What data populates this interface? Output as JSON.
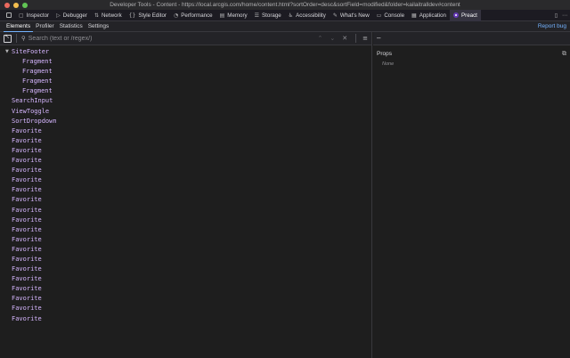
{
  "window": {
    "title": "Developer Tools - Content - https://local.arcgis.com/home/content.html?sortOrder=desc&sortField=modified&folder=kailaitralldev#content"
  },
  "toolbar": {
    "tabs": [
      {
        "label": "Inspector",
        "icon": "inspector-icon",
        "glyph": "▢"
      },
      {
        "label": "Debugger",
        "icon": "debugger-icon",
        "glyph": "▷"
      },
      {
        "label": "Network",
        "icon": "network-icon",
        "glyph": "⇅"
      },
      {
        "label": "Style Editor",
        "icon": "style-editor-icon",
        "glyph": "{}"
      },
      {
        "label": "Performance",
        "icon": "performance-icon",
        "glyph": "◔"
      },
      {
        "label": "Memory",
        "icon": "memory-icon",
        "glyph": "▤"
      },
      {
        "label": "Storage",
        "icon": "storage-icon",
        "glyph": "☰"
      },
      {
        "label": "Accessibility",
        "icon": "accessibility-icon",
        "glyph": "♿"
      },
      {
        "label": "What's New",
        "icon": "whats-new-icon",
        "glyph": "✎"
      },
      {
        "label": "Console",
        "icon": "console-icon",
        "glyph": "▭"
      },
      {
        "label": "Application",
        "icon": "application-icon",
        "glyph": "▦"
      },
      {
        "label": "Preact",
        "icon": "preact-icon",
        "glyph": ""
      }
    ]
  },
  "subtabs": {
    "items": [
      "Elements",
      "Profiler",
      "Statistics",
      "Settings"
    ],
    "report_label": "Report bug"
  },
  "search": {
    "placeholder": "Search (text or /regex/)"
  },
  "tree": {
    "nodes": [
      {
        "name": "SiteFooter",
        "depth": "root",
        "expanded": true
      },
      {
        "name": "Fragment",
        "depth": "d1"
      },
      {
        "name": "Fragment",
        "depth": "d1"
      },
      {
        "name": "Fragment",
        "depth": "d1"
      },
      {
        "name": "Fragment",
        "depth": "d1"
      },
      {
        "name": "SearchInput",
        "depth": "d0"
      },
      {
        "name": "ViewToggle",
        "depth": "d0"
      },
      {
        "name": "SortDropdown",
        "depth": "d0"
      },
      {
        "name": "Favorite",
        "depth": "d0"
      },
      {
        "name": "Favorite",
        "depth": "d0"
      },
      {
        "name": "Favorite",
        "depth": "d0"
      },
      {
        "name": "Favorite",
        "depth": "d0"
      },
      {
        "name": "Favorite",
        "depth": "d0"
      },
      {
        "name": "Favorite",
        "depth": "d0"
      },
      {
        "name": "Favorite",
        "depth": "d0"
      },
      {
        "name": "Favorite",
        "depth": "d0"
      },
      {
        "name": "Favorite",
        "depth": "d0"
      },
      {
        "name": "Favorite",
        "depth": "d0"
      },
      {
        "name": "Favorite",
        "depth": "d0"
      },
      {
        "name": "Favorite",
        "depth": "d0"
      },
      {
        "name": "Favorite",
        "depth": "d0"
      },
      {
        "name": "Favorite",
        "depth": "d0"
      },
      {
        "name": "Favorite",
        "depth": "d0"
      },
      {
        "name": "Favorite",
        "depth": "d0"
      },
      {
        "name": "Favorite",
        "depth": "d0"
      },
      {
        "name": "Favorite",
        "depth": "d0"
      },
      {
        "name": "Favorite",
        "depth": "d0"
      },
      {
        "name": "Favorite",
        "depth": "d0"
      }
    ]
  },
  "sidebar": {
    "header_symbol": "–",
    "props_title": "Props",
    "props_empty": "None"
  },
  "colors": {
    "component_name": "#d6b6ff",
    "accent_link": "#74b3ff",
    "preact_brand": "#673ab8"
  }
}
